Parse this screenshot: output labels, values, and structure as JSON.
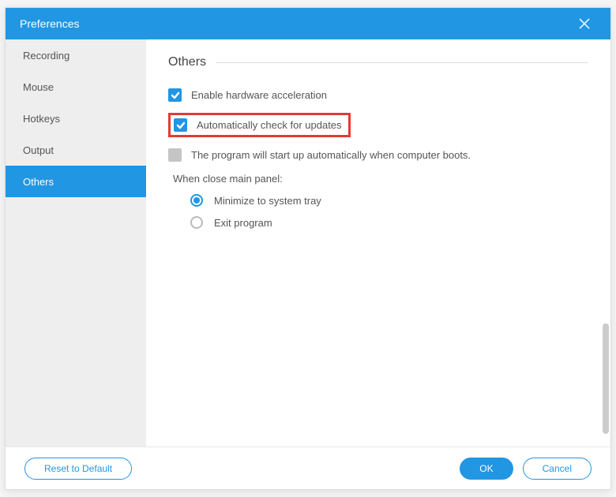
{
  "title": "Preferences",
  "sidebar": {
    "items": [
      {
        "label": "Recording",
        "active": false
      },
      {
        "label": "Mouse",
        "active": false
      },
      {
        "label": "Hotkeys",
        "active": false
      },
      {
        "label": "Output",
        "active": false
      },
      {
        "label": "Others",
        "active": true
      }
    ]
  },
  "section": {
    "title": "Others",
    "options": {
      "hardware_accel": {
        "label": "Enable hardware acceleration",
        "checked": true
      },
      "auto_update": {
        "label": "Automatically check for updates",
        "checked": true,
        "highlighted": true
      },
      "startup": {
        "label": "The program will start up automatically when computer boots.",
        "checked": false
      }
    },
    "close_panel": {
      "label": "When close main panel:",
      "radios": [
        {
          "label": "Minimize to system tray",
          "selected": true
        },
        {
          "label": "Exit program",
          "selected": false
        }
      ]
    }
  },
  "footer": {
    "reset": "Reset to Default",
    "ok": "OK",
    "cancel": "Cancel"
  }
}
